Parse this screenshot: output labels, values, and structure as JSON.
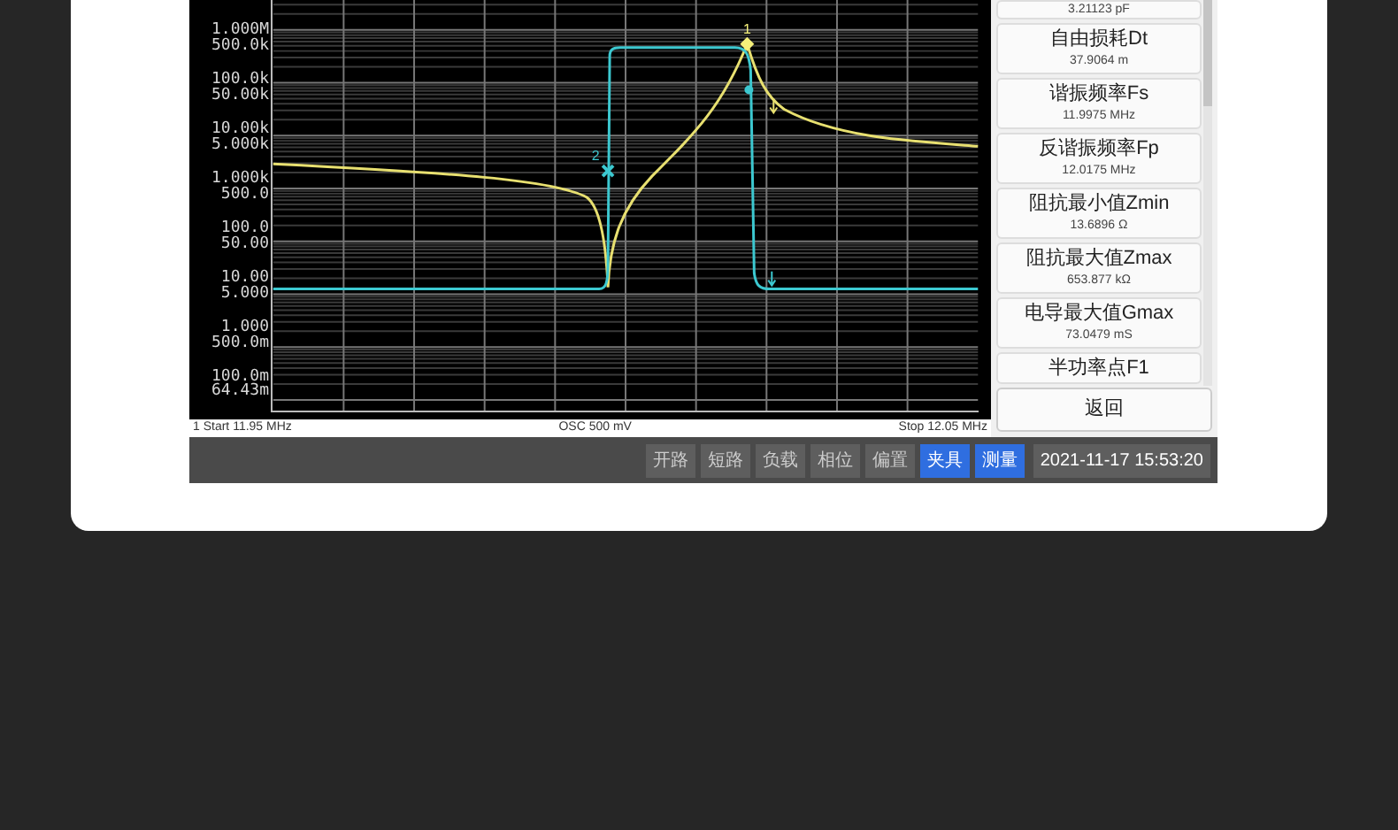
{
  "plot": {
    "y_labels": [
      [
        "1.000M",
        "500.0k"
      ],
      [
        "100.0k",
        "50.00k"
      ],
      [
        "10.00k",
        "5.000k"
      ],
      [
        "1.000k",
        "500.0"
      ],
      [
        "100.0",
        "50.00"
      ],
      [
        "10.00",
        "5.000"
      ],
      [
        "1.000",
        "500.0m"
      ],
      [
        "100.0m",
        "64.43m"
      ]
    ],
    "markers": [
      {
        "label": "1",
        "kind": "diamond"
      },
      {
        "label": "2",
        "kind": "cross"
      }
    ],
    "start": "1  Start  11.95 MHz",
    "center": "OSC 500 mV",
    "stop": "Stop  12.05 MHz"
  },
  "params": {
    "top_value": "3.21123 pF",
    "items": [
      {
        "title": "自由损耗Dt",
        "value": "37.9064 m"
      },
      {
        "title": "谐振频率Fs",
        "value": "11.9975 MHz"
      },
      {
        "title": "反谐振频率Fp",
        "value": "12.0175 MHz"
      },
      {
        "title": "阻抗最小值Zmin",
        "value": "13.6896 Ω"
      },
      {
        "title": "阻抗最大值Zmax",
        "value": "653.877 kΩ"
      },
      {
        "title": "电导最大值Gmax",
        "value": "73.0479 mS"
      },
      {
        "title": "半功率点F1"
      }
    ],
    "back": "返回"
  },
  "toolbar": {
    "buttons": [
      {
        "label": "开路",
        "selected": false
      },
      {
        "label": "短路",
        "selected": false
      },
      {
        "label": "负载",
        "selected": false
      },
      {
        "label": "相位",
        "selected": false
      },
      {
        "label": "偏置",
        "selected": false
      },
      {
        "label": "夹具",
        "selected": true
      },
      {
        "label": "测量",
        "selected": true
      }
    ],
    "datetime": "2021-11-17 15:53:20"
  }
}
